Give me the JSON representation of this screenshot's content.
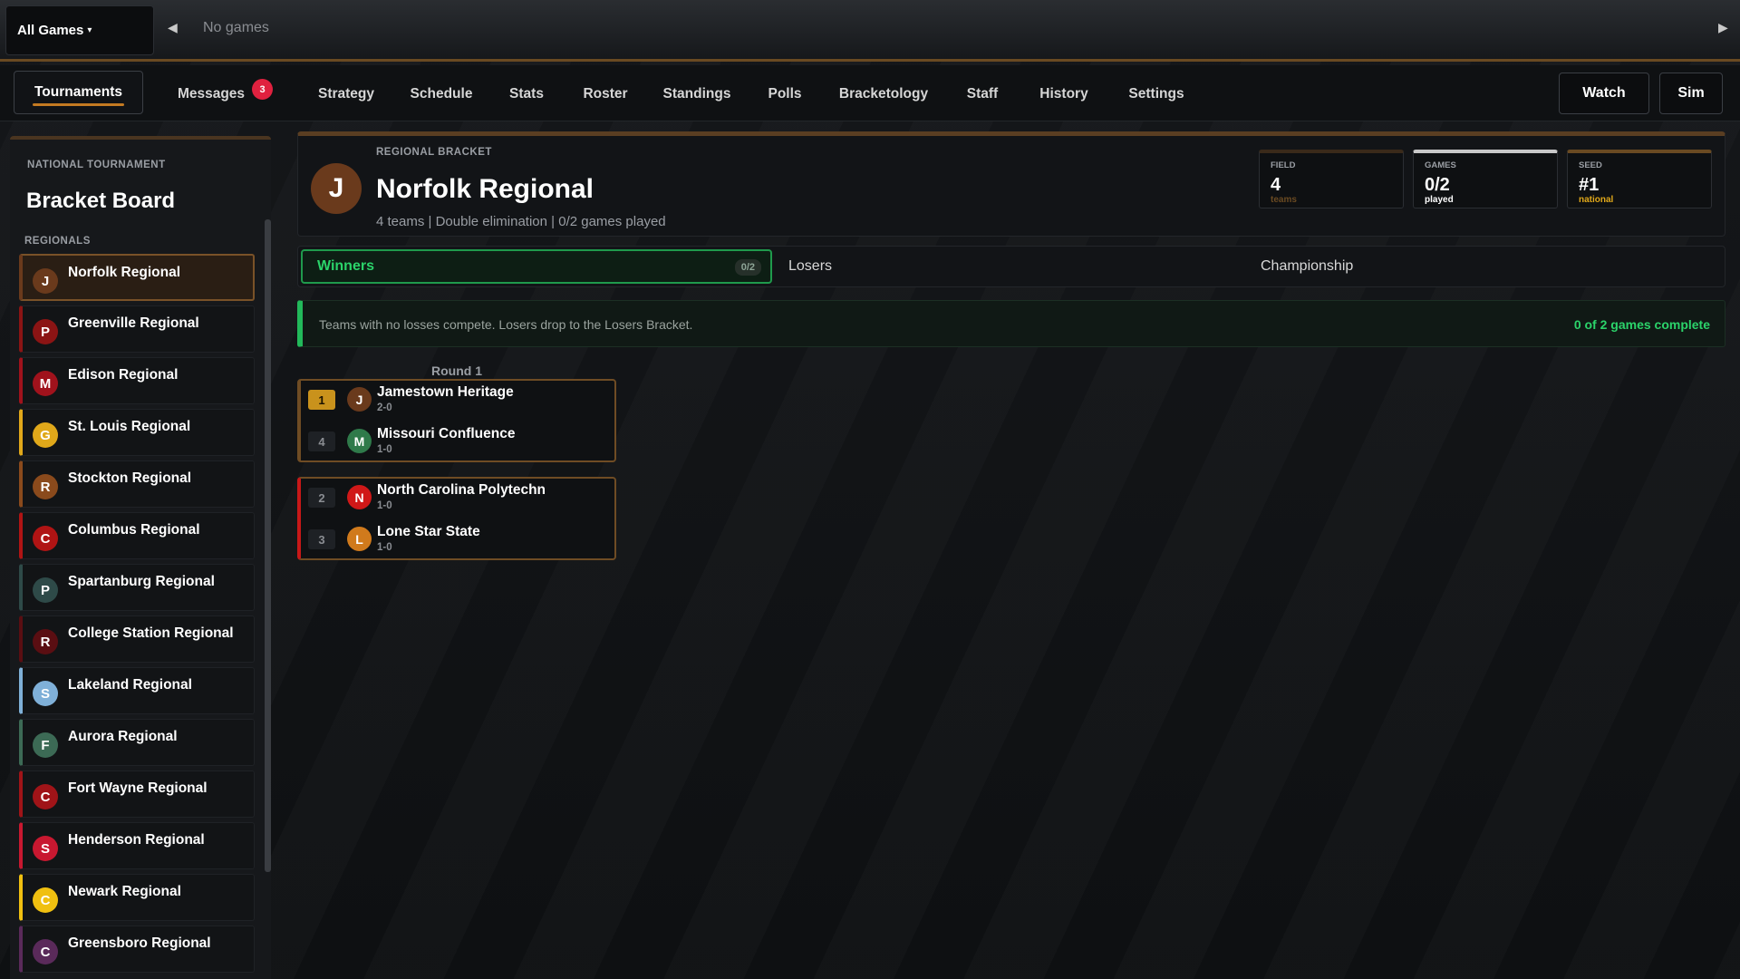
{
  "topbar": {
    "filter_label": "All Games",
    "empty_text": "No games"
  },
  "nav": {
    "tabs": [
      {
        "label": "Tournaments",
        "active": true
      },
      {
        "label": "Messages",
        "badge": "3"
      },
      {
        "label": "Strategy"
      },
      {
        "label": "Schedule"
      },
      {
        "label": "Stats"
      },
      {
        "label": "Roster"
      },
      {
        "label": "Standings"
      },
      {
        "label": "Polls"
      },
      {
        "label": "Bracketology"
      },
      {
        "label": "Staff"
      },
      {
        "label": "History"
      },
      {
        "label": "Settings"
      }
    ],
    "watch_label": "Watch",
    "sim_label": "Sim"
  },
  "sidebar": {
    "kicker": "NATIONAL TOURNAMENT",
    "title": "Bracket Board",
    "section_label": "REGIONALS",
    "items": [
      {
        "letter": "J",
        "label": "Norfolk Regional",
        "color": "#6a3a1c",
        "stripe": "#6a3a1c",
        "active": true
      },
      {
        "letter": "P",
        "label": "Greenville Regional",
        "color": "#8b1414",
        "stripe": "#8b1414"
      },
      {
        "letter": "M",
        "label": "Edison Regional",
        "color": "#a0121c",
        "stripe": "#a0121c"
      },
      {
        "letter": "G",
        "label": "St. Louis Regional",
        "color": "#e0a81a",
        "stripe": "#e0a81a"
      },
      {
        "letter": "R",
        "label": "Stockton Regional",
        "color": "#8a4a1c",
        "stripe": "#8a4a1c"
      },
      {
        "letter": "C",
        "label": "Columbus Regional",
        "color": "#b01414",
        "stripe": "#b01414"
      },
      {
        "letter": "P",
        "label": "Spartanburg Regional",
        "color": "#2e4a48",
        "stripe": "#2e4a48"
      },
      {
        "letter": "R",
        "label": "College Station Regional",
        "color": "#5a0e12",
        "stripe": "#5a0e12"
      },
      {
        "letter": "S",
        "label": "Lakeland Regional",
        "color": "#7fb0d8",
        "stripe": "#7fb0d8"
      },
      {
        "letter": "F",
        "label": "Aurora Regional",
        "color": "#3c6a55",
        "stripe": "#3c6a55"
      },
      {
        "letter": "C",
        "label": "Fort Wayne Regional",
        "color": "#a01418",
        "stripe": "#a01418"
      },
      {
        "letter": "S",
        "label": "Henderson Regional",
        "color": "#c81830",
        "stripe": "#c81830"
      },
      {
        "letter": "C",
        "label": "Newark Regional",
        "color": "#f0c010",
        "stripe": "#f0c010"
      },
      {
        "letter": "C",
        "label": "Greensboro Regional",
        "color": "#5a2a5a",
        "stripe": "#5a2a5a"
      }
    ]
  },
  "header": {
    "avatar_letter": "J",
    "kicker": "REGIONAL BRACKET",
    "title": "Norfolk Regional",
    "subtitle": "4 teams | Double elimination | 0/2 games played",
    "stats": [
      {
        "key": "FIELD",
        "value": "4",
        "unit": "teams",
        "unit_color": "#6a4a22",
        "top_color": "#3a2a1a"
      },
      {
        "key": "GAMES",
        "value": "0/2",
        "unit": "played",
        "unit_color": "#ffffff",
        "top_color": "#c8c8c8"
      },
      {
        "key": "SEED",
        "value": "#1",
        "unit": "national",
        "unit_color": "#e0a81a",
        "top_color": "#6a4a22"
      }
    ]
  },
  "bracket_tabs": {
    "winners": "Winners",
    "winners_count": "0/2",
    "losers": "Losers",
    "championship": "Championship"
  },
  "info": {
    "message": "Teams with no losses compete. Losers drop to the Losers Bracket.",
    "progress": "0 of 2 games complete"
  },
  "round": {
    "label": "Round 1",
    "matchups": [
      {
        "stripe": "#6f4c24",
        "teams": [
          {
            "seed": "1",
            "top_seed": true,
            "letter": "J",
            "color": "#6a3a1c",
            "name": "Jamestown Heritage",
            "record": "2-0"
          },
          {
            "seed": "4",
            "letter": "M",
            "color": "#2f7a4a",
            "name": "Missouri Confluence",
            "record": "1-0"
          }
        ]
      },
      {
        "stripe": "#c81818",
        "teams": [
          {
            "seed": "2",
            "letter": "N",
            "color": "#d01818",
            "name": "North Carolina Polytechn",
            "record": "1-0"
          },
          {
            "seed": "3",
            "letter": "L",
            "color": "#d07a1c",
            "name": "Lone Star State",
            "record": "1-0"
          }
        ]
      }
    ]
  }
}
